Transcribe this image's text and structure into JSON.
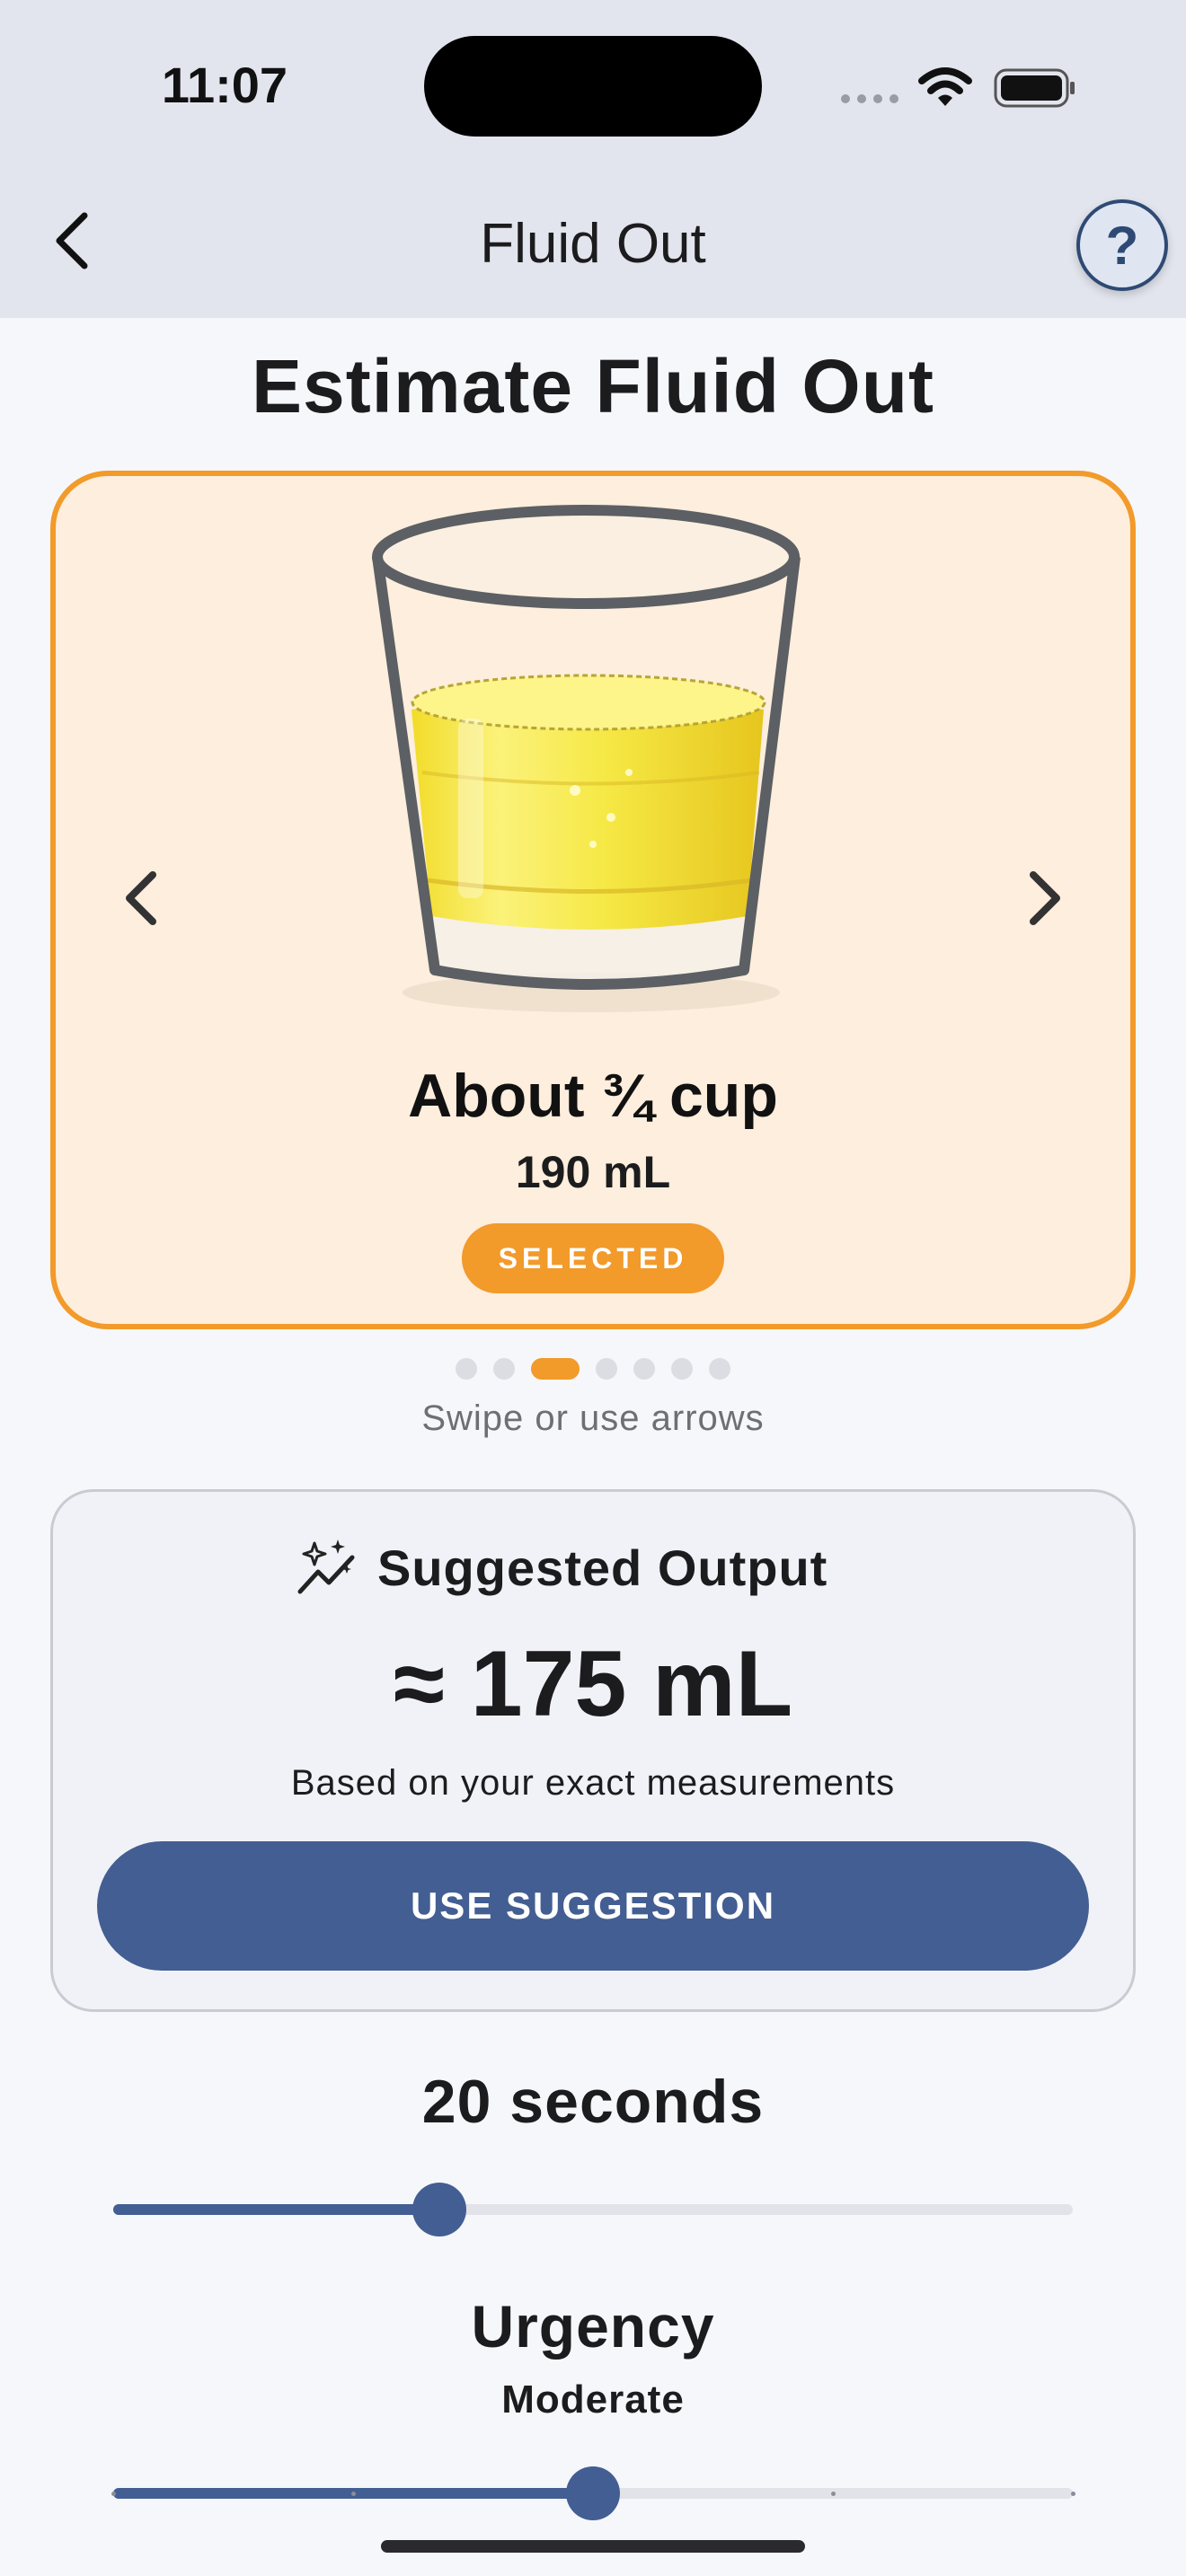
{
  "status_bar": {
    "time": "11:07"
  },
  "nav": {
    "title": "Fluid Out",
    "help_label": "?"
  },
  "page": {
    "title": "Estimate Fluid Out"
  },
  "estimate": {
    "label": "About ¾ cup",
    "volume": "190 mL",
    "badge": "SELECTED",
    "page_count": 7,
    "active_page": 2,
    "hint": "Swipe or use arrows"
  },
  "suggestion": {
    "title": "Suggested Output",
    "value": "≈ 175 mL",
    "note": "Based on your exact measurements",
    "button_label": "USE SUGGESTION"
  },
  "duration": {
    "label": "20 seconds",
    "slider_fraction": 0.34
  },
  "urgency": {
    "title": "Urgency",
    "value": "Moderate",
    "slider_fraction": 0.5,
    "steps": 4
  },
  "colors": {
    "accent": "#f29a2a",
    "primary": "#435e92",
    "card_bg": "#fdeedd",
    "liquid": "#f5e43a"
  }
}
